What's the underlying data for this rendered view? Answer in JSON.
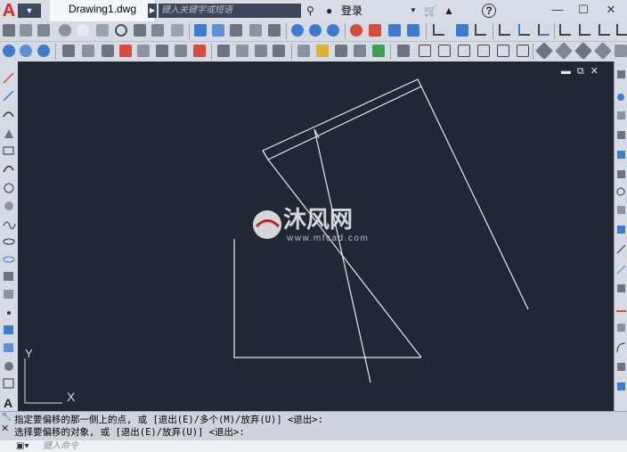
{
  "titlebar": {
    "app_logo": "A",
    "document_tab": "Drawing1.dwg",
    "search_placeholder": "键入关键字或短语",
    "login_label": "登录",
    "help_label": "?"
  },
  "canvas": {
    "background": "#222833",
    "line_color": "#e8eaee",
    "watermark_cn": "沐风网",
    "watermark_url": "www.mfcad.com",
    "ucs_x": "X",
    "ucs_y": "Y"
  },
  "command": {
    "history_line1": "指定要偏移的那一侧上的点, 或 [退出(E)/多个(M)/放弃(U)] <退出>:",
    "history_line2": "选择要偏移的对象, 或 [退出(E)/放弃(U)] <退出>:",
    "input_placeholder": "键入命令"
  }
}
